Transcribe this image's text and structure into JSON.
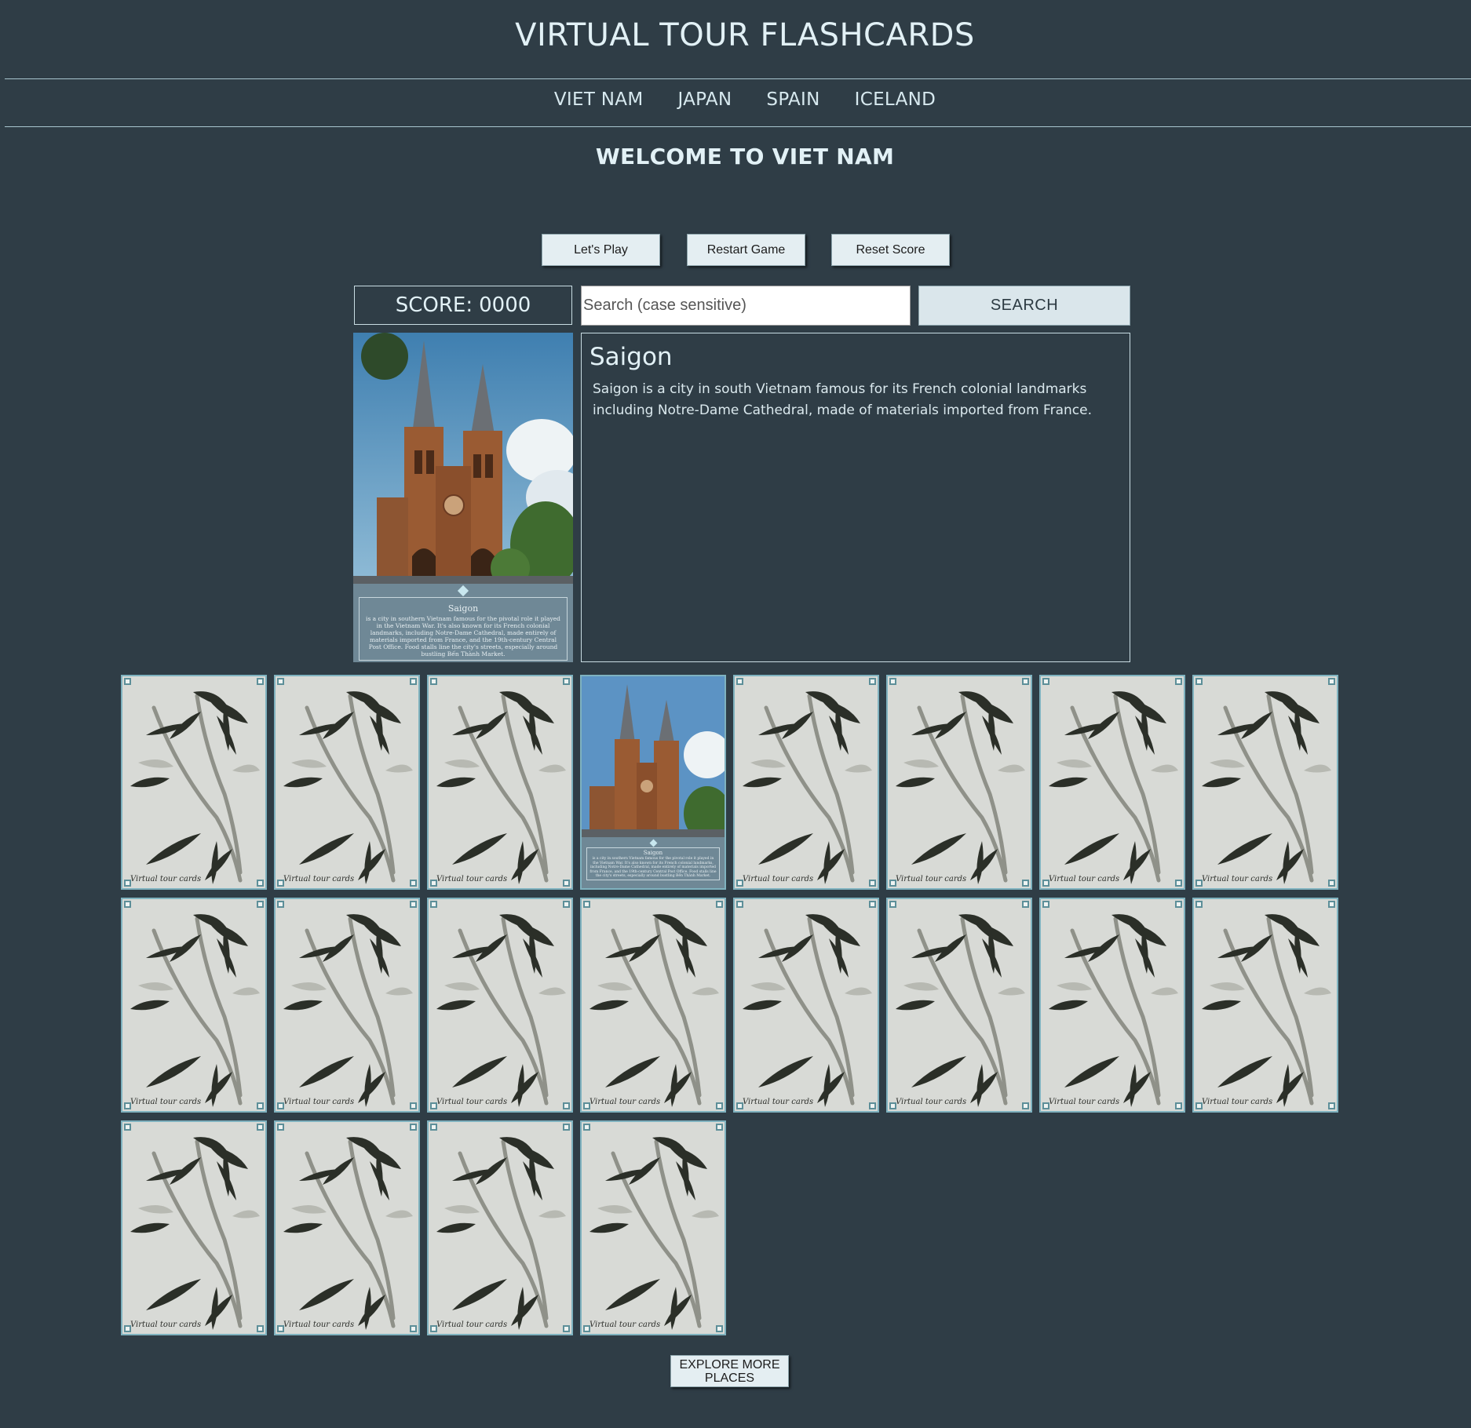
{
  "header": {
    "title": "VIRTUAL TOUR FLASHCARDS"
  },
  "nav": {
    "items": [
      "VIET NAM",
      "JAPAN",
      "SPAIN",
      "ICELAND"
    ]
  },
  "welcome": "WELCOME TO VIET NAM",
  "controls": {
    "play_label": "Let's Play",
    "restart_label": "Restart Game",
    "reset_label": "Reset Score"
  },
  "score": {
    "label": "SCORE:",
    "value": "0000"
  },
  "search": {
    "placeholder": "Search (case sensitive)",
    "value": "",
    "button_label": "SEARCH"
  },
  "featured": {
    "name": "Saigon",
    "description": "Saigon is a city in south Vietnam famous for its French colonial landmarks including Notre-Dame Cathedral, made of materials imported from France.",
    "card_caption": "is a city in southern Vietnam famous for the pivotal role it played in the Vietnam War. It's also known for its French colonial landmarks, including Notre-Dame Cathedral, made entirely of materials imported from France, and the 19th-century Central Post Office. Food stalls line the city's streets, especially around bustling Bến Thành Market."
  },
  "card_back": {
    "signature": "Virtual tour cards"
  },
  "cards": {
    "count": 20,
    "per_row": 8,
    "revealed_index": 3
  },
  "explore": {
    "label": "EXPLORE MORE PLACES"
  },
  "colors": {
    "background": "#2f3d46",
    "accent_border": "#7fb2bf",
    "text": "#e2f1f6"
  }
}
